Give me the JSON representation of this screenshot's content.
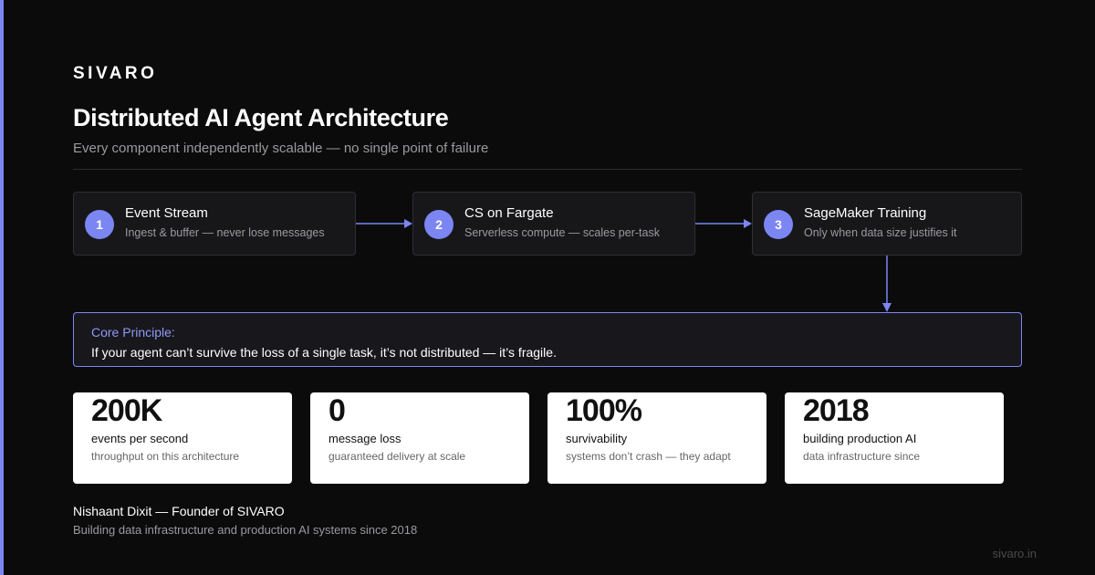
{
  "brand": "SIVARO",
  "title": "Distributed AI Agent Architecture",
  "subtitle": "Every component independently scalable — no single point of failure",
  "steps": [
    {
      "number": "1",
      "title": "Event Stream",
      "description": "Ingest & buffer — never lose messages"
    },
    {
      "number": "2",
      "title": "CS on Fargate",
      "description": "Serverless compute — scales per-task"
    },
    {
      "number": "3",
      "title": "SageMaker Training",
      "description": "Only when data size justifies it"
    }
  ],
  "principle": {
    "label": "Core Principle:",
    "text": "If your agent can’t survive the loss of a single task, it’s not distributed — it’s fragile."
  },
  "stats": [
    {
      "value": "200K",
      "label": "events per second",
      "note": "throughput on this architecture"
    },
    {
      "value": "0",
      "label": "message loss",
      "note": "guaranteed delivery at scale"
    },
    {
      "value": "100%",
      "label": "survivability",
      "note": "systems don’t crash — they adapt"
    },
    {
      "value": "2018",
      "label": "building production AI",
      "note": "data infrastructure since"
    }
  ],
  "author": {
    "name": "Nishaant Dixit — Founder of SIVARO",
    "bio": "Building data infrastructure and production AI systems since 2018"
  },
  "site": "sivaro.in",
  "colors": {
    "background": "#0b0b0b",
    "accent": "#7b86f3",
    "card": "#17171a",
    "stat_card": "#ffffff"
  }
}
